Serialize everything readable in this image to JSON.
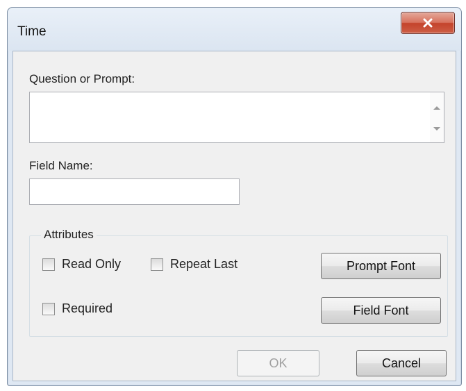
{
  "window": {
    "title": "Time"
  },
  "prompt": {
    "label": "Question or Prompt:",
    "value": ""
  },
  "field_name": {
    "label": "Field Name:",
    "value": ""
  },
  "attributes": {
    "legend": "Attributes",
    "read_only": {
      "label": "Read Only",
      "checked": false
    },
    "repeat_last": {
      "label": "Repeat Last",
      "checked": false
    },
    "required": {
      "label": "Required",
      "checked": false
    },
    "prompt_font": "Prompt Font",
    "field_font": "Field Font"
  },
  "buttons": {
    "ok": "OK",
    "cancel": "Cancel"
  },
  "icons": {
    "close": "close-icon",
    "scroll_up": "scroll-up-icon",
    "scroll_down": "scroll-down-icon"
  },
  "colors": {
    "close_button": "#c4432b",
    "dialog_background": "#f0f0f0",
    "frame": "#dfe8f3"
  }
}
